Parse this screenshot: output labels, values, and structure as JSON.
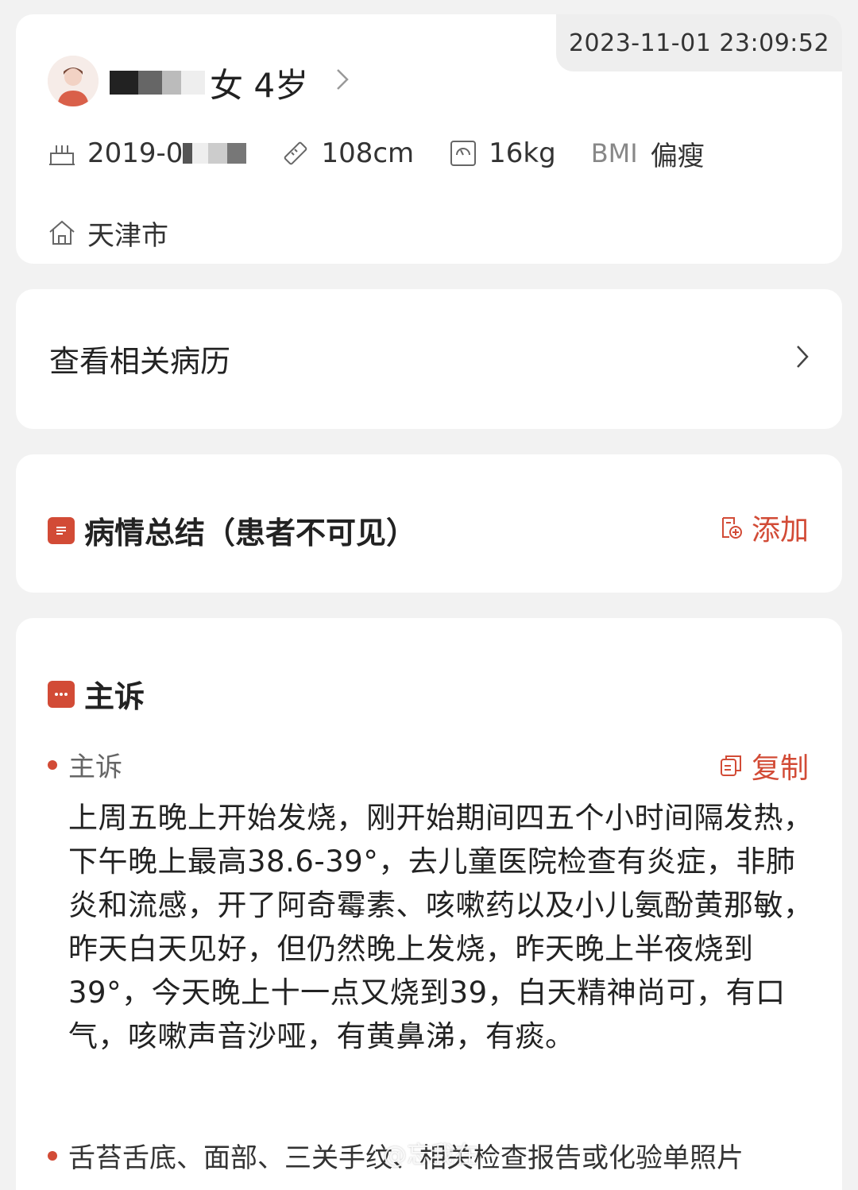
{
  "patient": {
    "timestamp": "2023-11-01 23:09:52",
    "gender_age": "女 4岁",
    "birth_date": "2019-0",
    "height": "108cm",
    "weight": "16kg",
    "bmi_label": "BMI",
    "bmi_value": "偏瘦",
    "city": "天津市"
  },
  "history": {
    "label": "查看相关病历"
  },
  "summary": {
    "title": "病情总结（患者不可见）",
    "action_label": "添加"
  },
  "complaint": {
    "title": "主诉",
    "sub_label": "主诉",
    "copy_label": "复制",
    "text": "上周五晚上开始发烧，刚开始期间四五个小时间隔发热，下午晚上最高38.6-39°，去儿童医院检查有炎症，非肺炎和流感，开了阿奇霉素、咳嗽药以及小儿氨酚黄那敏，昨天白天见好，但仍然晚上发烧，昨天晚上半夜烧到39°，今天晚上十一点又烧到39，白天精神尚可，有口气，咳嗽声音沙哑，有黄鼻涕，有痰。",
    "next_item_label": "舌苔舌底、面部、三关手纹、相关检查报告或化验单照片"
  },
  "watermark": "@忘我在",
  "colors": {
    "accent": "#d24b36",
    "background": "#f2f2f2",
    "card": "#ffffff"
  },
  "icons": [
    "avatar-icon",
    "chevron-right-icon",
    "birthday-cake-icon",
    "ruler-icon",
    "scale-icon",
    "home-icon",
    "document-icon",
    "add-note-icon",
    "chat-icon",
    "copy-icon"
  ]
}
